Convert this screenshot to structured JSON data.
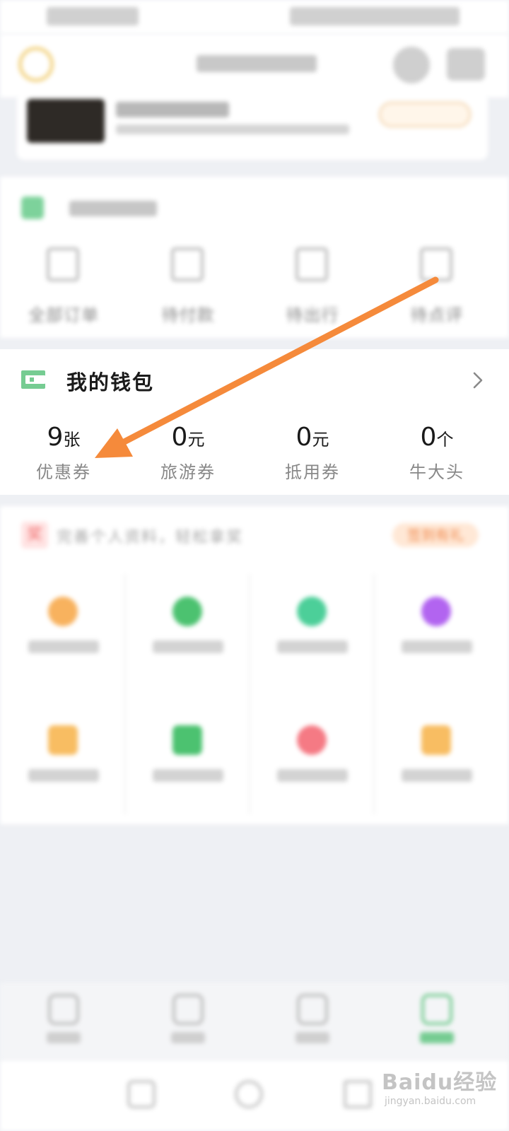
{
  "wallet": {
    "title": "我的钱包",
    "stats": [
      {
        "value": "9",
        "unit": "张",
        "label": "优惠券"
      },
      {
        "value": "0",
        "unit": "元",
        "label": "旅游券"
      },
      {
        "value": "0",
        "unit": "元",
        "label": "抵用券"
      },
      {
        "value": "0",
        "unit": "个",
        "label": "牛大头"
      }
    ]
  },
  "orders": {
    "tabs": [
      {
        "label": "全部订单"
      },
      {
        "label": "待付款"
      },
      {
        "label": "待出行"
      },
      {
        "label": "待点评"
      }
    ]
  },
  "perks": {
    "badge": "奖",
    "tip": "完善个人资料，轻松拿奖",
    "signin": "签到有礼"
  },
  "watermark": {
    "brand": "Baidu经验",
    "url": "jingyan.baidu.com"
  },
  "colors": {
    "accent_green": "#76cc92",
    "annotation_arrow": "#f58a3b"
  }
}
